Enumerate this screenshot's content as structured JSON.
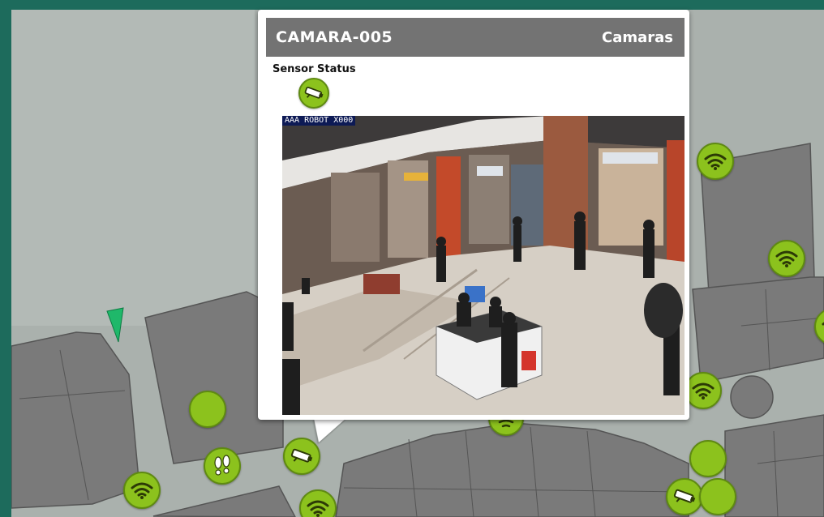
{
  "popup": {
    "title": "CAMARA-005",
    "category": "Camaras",
    "status_label": "Sensor Status",
    "status_icon": "cctv-camera-icon",
    "feed_overlay": "AAA ROBOT X000"
  },
  "colors": {
    "frame": "#1d6b5c",
    "map_background": "#aab1ad",
    "building": "#7a7a7a",
    "marker": "#8cc21d",
    "header": "#737373"
  },
  "markers": [
    {
      "type": "wifi",
      "icon": "wifi-icon"
    },
    {
      "type": "wifi",
      "icon": "wifi-icon"
    },
    {
      "type": "wifi",
      "icon": "wifi-icon"
    },
    {
      "type": "wifi",
      "icon": "wifi-icon"
    },
    {
      "type": "wifi",
      "icon": "wifi-icon"
    },
    {
      "type": "wifi",
      "icon": "wifi-icon"
    },
    {
      "type": "camera",
      "icon": "cctv-camera-icon"
    },
    {
      "type": "camera",
      "icon": "cctv-camera-icon"
    },
    {
      "type": "footsteps",
      "icon": "footsteps-icon"
    },
    {
      "type": "plain",
      "icon": "circle-marker"
    }
  ]
}
